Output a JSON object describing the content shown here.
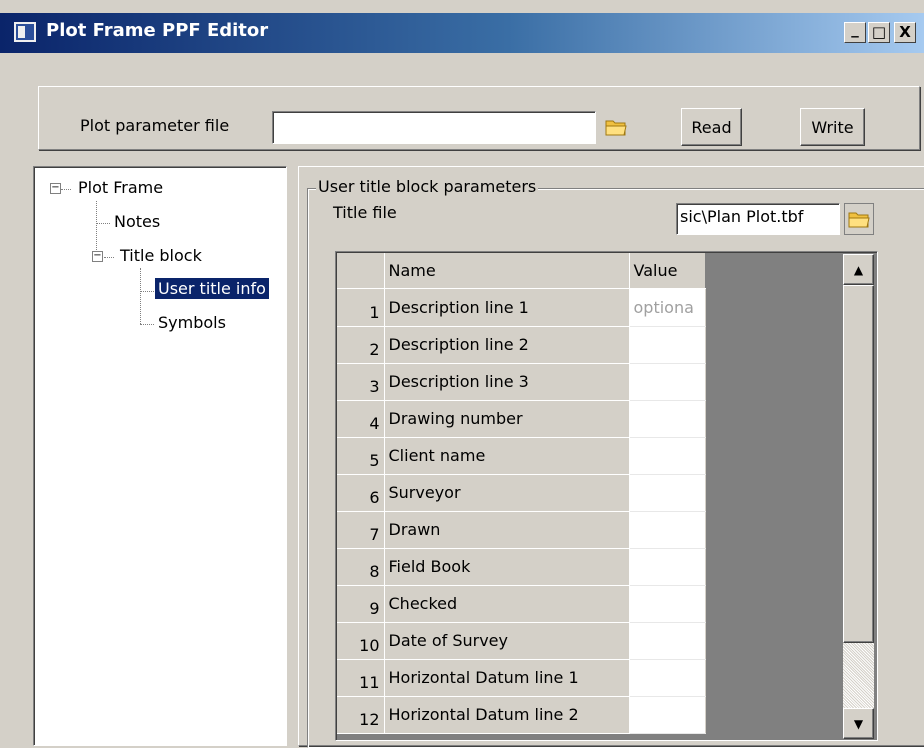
{
  "window": {
    "title": "Plot Frame PPF Editor",
    "minimize": "_",
    "maximize": "□",
    "close": "X"
  },
  "ppf": {
    "label": "Plot parameter file",
    "value": "",
    "read_label": "Read",
    "write_label": "Write"
  },
  "tree": {
    "root": "Plot Frame",
    "notes": "Notes",
    "title_block": "Title block",
    "user_title_info": "User title info",
    "symbols": "Symbols",
    "collapse_glyph": "−"
  },
  "group": {
    "title": "User title block parameters",
    "title_file_label": "Title file",
    "title_file_value": "sic\\Plan Plot.tbf"
  },
  "grid": {
    "headers": {
      "num": "",
      "name": "Name",
      "value": "Value"
    },
    "rows": [
      {
        "num": "1",
        "name": "Description line 1",
        "value": "optiona"
      },
      {
        "num": "2",
        "name": "Description line 2",
        "value": ""
      },
      {
        "num": "3",
        "name": "Description line 3",
        "value": ""
      },
      {
        "num": "4",
        "name": "Drawing number",
        "value": ""
      },
      {
        "num": "5",
        "name": "Client name",
        "value": ""
      },
      {
        "num": "6",
        "name": "Surveyor",
        "value": ""
      },
      {
        "num": "7",
        "name": "Drawn",
        "value": ""
      },
      {
        "num": "8",
        "name": "Field Book",
        "value": ""
      },
      {
        "num": "9",
        "name": "Checked",
        "value": ""
      },
      {
        "num": "10",
        "name": "Date of Survey",
        "value": ""
      },
      {
        "num": "11",
        "name": "Horizontal Datum line 1",
        "value": ""
      },
      {
        "num": "12",
        "name": "Horizontal Datum line 2",
        "value": ""
      }
    ]
  },
  "scrollbar": {
    "up_glyph": "▲",
    "down_glyph": "▼"
  },
  "colors": {
    "face": "#d4d0c8",
    "title_start": "#0a246a",
    "title_end": "#a6caf0",
    "selection": "#0a246a",
    "grid_empty": "#808080"
  }
}
